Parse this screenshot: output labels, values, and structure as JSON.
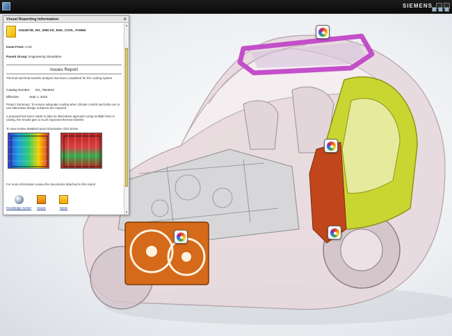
{
  "app": {
    "brand": "SIEMENS"
  },
  "panel": {
    "window_title": "Visual Reporting Information",
    "close_glyph": "×",
    "document_id": "K5249738_002_SIMCAD_ENG_COOL_FANM4",
    "issue_from_label": "Issue From:",
    "issue_from_value": "CAE",
    "parent_group_label": "Parent Group:",
    "parent_group_value": "Engineering Simulation",
    "report_title": "Issues Report",
    "summary_line": "Thermal and heat transfer analysis has been completed for the cooling system",
    "catalog_label": "Catalog Number:",
    "catalog_value": "DS_7654643",
    "effective_label": "Effective:",
    "effective_value": "Sept 1, 2010",
    "project_summary": "Project Summary: To ensure adequate cooling when climate control and turbo are in use alternative design solutions are required",
    "proposal": "A proposal has been made to take an alternative approach using multiple fans in casing, the results give a much improved thermal transfer",
    "review_line": "To view review detailed report information click below",
    "more_info": "For more information review the documents attached to this report",
    "links": [
      {
        "label": "Knowledge Center",
        "icon": "globe-icon"
      },
      {
        "label": "Issues",
        "icon": "issues-icon"
      },
      {
        "label": "Notes",
        "icon": "notes-icon"
      }
    ]
  },
  "colors": {
    "sunroof": "#c34fc9",
    "door": "#c9d631",
    "pillar": "#c2461c",
    "radiator": "#d46a1a"
  }
}
